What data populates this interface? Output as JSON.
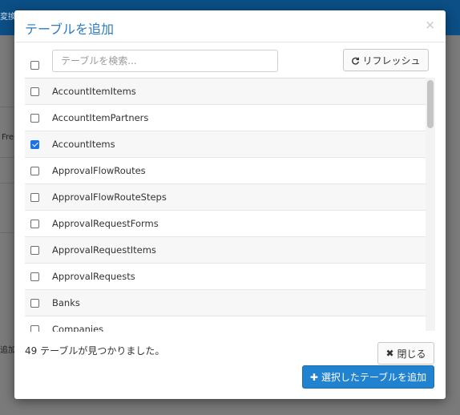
{
  "background": {
    "fragment_top": "変換",
    "fragment_mid": "Fre",
    "fragment_bottom": "追加"
  },
  "dialog": {
    "title": "テーブルを追加",
    "close_glyph": "×"
  },
  "search": {
    "placeholder": "テーブルを検索..."
  },
  "refresh_button": {
    "icon": "refresh-icon",
    "label": "リフレッシュ"
  },
  "tables": [
    {
      "name": "AccountItemItems",
      "checked": false
    },
    {
      "name": "AccountItemPartners",
      "checked": false
    },
    {
      "name": "AccountItems",
      "checked": true
    },
    {
      "name": "ApprovalFlowRoutes",
      "checked": false
    },
    {
      "name": "ApprovalFlowRouteSteps",
      "checked": false
    },
    {
      "name": "ApprovalRequestForms",
      "checked": false
    },
    {
      "name": "ApprovalRequestItems",
      "checked": false
    },
    {
      "name": "ApprovalRequests",
      "checked": false
    },
    {
      "name": "Banks",
      "checked": false
    },
    {
      "name": "Companies",
      "checked": false
    }
  ],
  "footer": {
    "count_text": "49 テーブルが見つかりました。",
    "close_label": "閉じる",
    "add_label": "選択したテーブルを追加"
  },
  "colors": {
    "accent": "#2182cf",
    "title": "#2a7bbf",
    "checkbox_checked": "#1a73e8"
  }
}
